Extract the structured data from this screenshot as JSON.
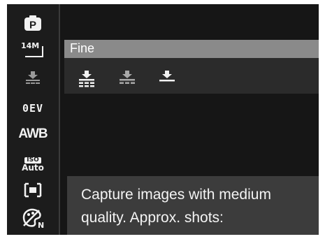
{
  "sidebar": {
    "mode_label": "P",
    "image_size_label": "14M",
    "ev_label": "0EV",
    "white_balance_label": "AWB",
    "iso_badge_label": "ISO",
    "iso_value_label": "Auto"
  },
  "menu": {
    "selected_item_label": "Fine",
    "quality_options": [
      "super-fine-icon",
      "fine-icon",
      "normal-icon"
    ]
  },
  "help": {
    "line1": "Capture images with medium",
    "line2": "quality. Approx. shots:"
  },
  "colors": {
    "background": "#141414",
    "highlight": "#8a8a8a",
    "options_strip": "#2b2b2b",
    "help_box": "#3c3c3c",
    "text": "#ffffff"
  }
}
